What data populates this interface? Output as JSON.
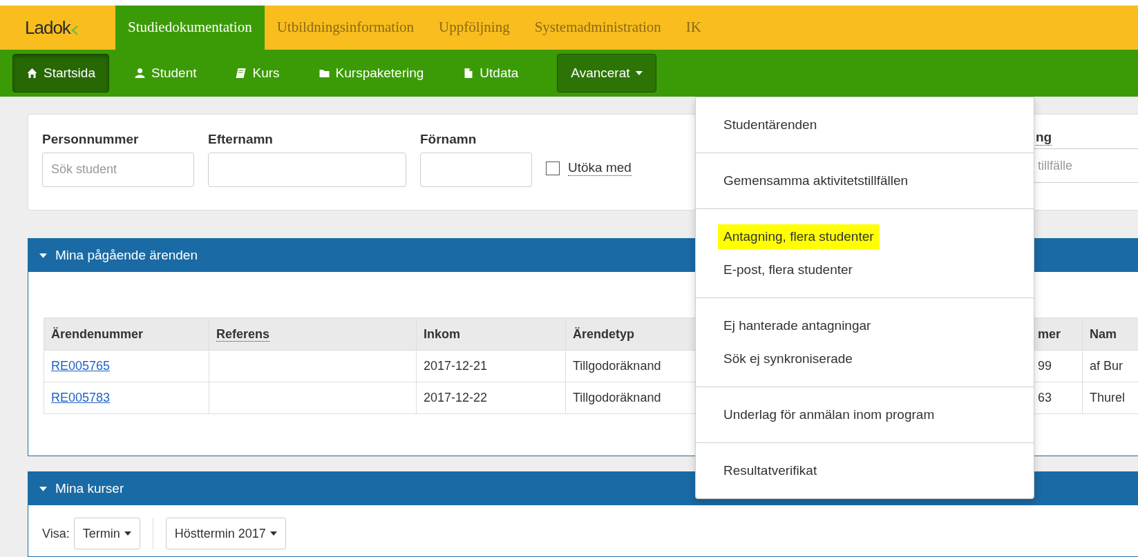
{
  "brand": {
    "logo": "Ladok"
  },
  "modules": [
    {
      "label": "Studiedokumentation",
      "selected": true
    },
    {
      "label": "Utbildningsinformation",
      "selected": false
    },
    {
      "label": "Uppföljning",
      "selected": false
    },
    {
      "label": "Systemadministration",
      "selected": false
    },
    {
      "label": "IK",
      "selected": false
    }
  ],
  "nav": [
    {
      "label": "Startsida",
      "kind": "house",
      "selected": true,
      "expanded": false,
      "has_menu": false
    },
    {
      "label": "Student",
      "kind": "user",
      "selected": false,
      "expanded": false,
      "has_menu": false
    },
    {
      "label": "Kurs",
      "kind": "book",
      "selected": false,
      "expanded": false,
      "has_menu": false
    },
    {
      "label": "Kurspaketering",
      "kind": "folder",
      "selected": false,
      "expanded": false,
      "has_menu": false
    },
    {
      "label": "Utdata",
      "kind": "file",
      "selected": false,
      "expanded": false,
      "has_menu": false
    },
    {
      "label": "Avancerat",
      "kind": "none",
      "selected": false,
      "expanded": true,
      "has_menu": true
    }
  ],
  "dropdown_menu": [
    [
      {
        "label": "Studentärenden",
        "highlighted": false
      }
    ],
    [
      {
        "label": "Gemensamma aktivitetstillfällen",
        "highlighted": false
      }
    ],
    [
      {
        "label": "Antagning, flera studenter",
        "highlighted": true
      },
      {
        "label": "E-post, flera studenter",
        "highlighted": false
      }
    ],
    [
      {
        "label": "Ej hanterade antagningar",
        "highlighted": false
      },
      {
        "label": "Sök ej synkroniserade",
        "highlighted": false
      }
    ],
    [
      {
        "label": "Underlag för anmälan inom program",
        "highlighted": false
      }
    ],
    [
      {
        "label": "Resultatverifikat",
        "highlighted": false
      }
    ]
  ],
  "search_form": {
    "fields": [
      {
        "label": "Personnummer",
        "placeholder": "Sök student"
      },
      {
        "label": "Efternamn"
      },
      {
        "label": "Förnamn"
      }
    ],
    "checkbox": {
      "label": "Utöka med",
      "checked": false
    },
    "field_4": {
      "label": "ng",
      "placeholder": "tillfälle"
    }
  },
  "panels": [
    {
      "title": "Mina pågående ärenden",
      "expanded": true,
      "table": {
        "columns": [
          "Ärendenummer",
          "Referens",
          "Inkom",
          "Ärendetyp",
          "",
          "mer",
          "Nam"
        ],
        "rows": [
          [
            "RE005765",
            "",
            "2017-12-21",
            "Tillgodoräknand",
            "",
            "99",
            "af Bur"
          ],
          [
            "RE005783",
            "",
            "2017-12-22",
            "Tillgodoräknand",
            "",
            "63",
            "Thurel"
          ]
        ]
      }
    },
    {
      "title": "Mina kurser",
      "expanded": true,
      "filter": {
        "label": "Visa:",
        "period_type": "Termin",
        "period": "Hösttermin 2017"
      }
    }
  ]
}
